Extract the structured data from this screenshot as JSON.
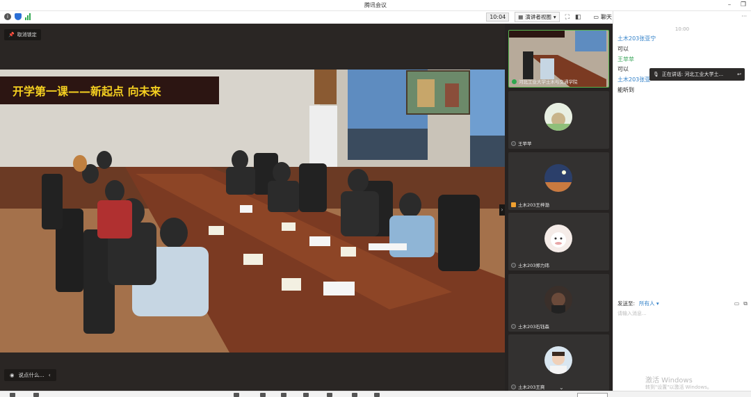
{
  "window": {
    "title": "腾讯会议"
  },
  "toolbar": {
    "time": "10:04",
    "view_label": "演讲者视图",
    "chat_tab": "聊天"
  },
  "stage": {
    "pin_label": "取消锁定",
    "say_placeholder": "说点什么...",
    "banner_text": "开学第一课——新起点 向未来"
  },
  "participants": [
    {
      "name": "河北工业大学土木与交通学院",
      "mic": "green",
      "active": true
    },
    {
      "name": "王苹苹",
      "mic": "muted"
    },
    {
      "name": "土木203王梓渤",
      "mic": "orange"
    },
    {
      "name": "土木203郑力玮",
      "mic": "muted"
    },
    {
      "name": "土木203石钰森",
      "mic": "muted"
    },
    {
      "name": "土木203王爽",
      "mic": "muted"
    }
  ],
  "chat": {
    "time": "10:00",
    "messages": [
      {
        "sender": "土木203张亚宁",
        "text": "可以",
        "color": "#2f7fc8"
      },
      {
        "sender": "王苹苹",
        "text": "可以",
        "color": "#3aa55b"
      },
      {
        "sender": "土木203张亚",
        "text": "能听到",
        "color": "#2f7fc8"
      }
    ],
    "speaking_label": "正在讲话: 河北工业大学土...",
    "send_to_label": "发送至:",
    "send_target": "所有人",
    "input_placeholder": "请输入消息...",
    "activate_title": "激活 Windows",
    "activate_sub": "转到\"设置\"以激活 Windows。"
  }
}
